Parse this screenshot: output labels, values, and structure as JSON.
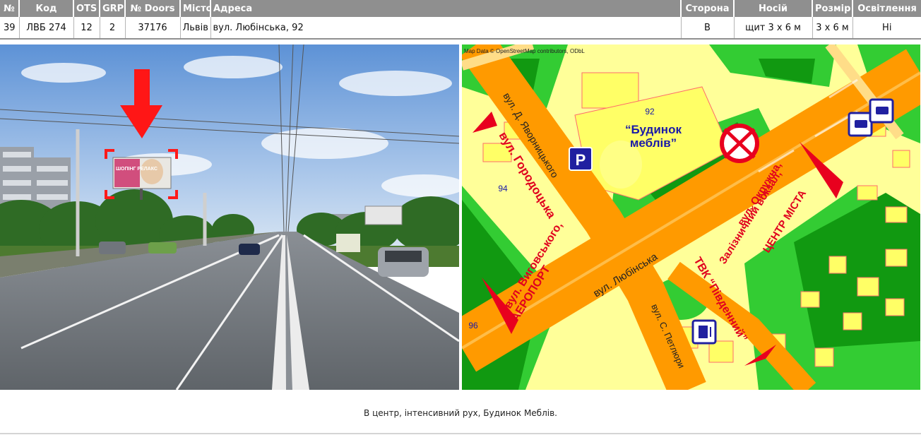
{
  "table": {
    "headers": [
      "№",
      "Код",
      "OTS",
      "GRP",
      "№ Doors",
      "Місто",
      "Адреса",
      "Сторона",
      "Носій",
      "Розмір",
      "Освітлення"
    ],
    "row": [
      "39",
      "ЛВБ 274",
      "12",
      "2",
      "37176",
      "Львів",
      "вул. Любінська, 92",
      "В",
      "щит 3 х 6 м",
      "3 х 6 м",
      "Ні"
    ]
  },
  "photo": {
    "billboard_text": "ШОПІНГ РЕЛАКС"
  },
  "map": {
    "attribution": "Map Data © OpenStreetMap contributors, ODbL",
    "house_92": "92",
    "house_94": "94",
    "house_96": "96",
    "parking_letter": "P",
    "furniture_line1": "“Будинок",
    "furniture_line2": "меблів”",
    "street_yavornytskoho": "вул. Д. Яворницького",
    "street_horodotska": "вул. Городоцька",
    "street_vyhovskoho_1": "вул. Виговського,",
    "street_vyhovskoho_2": "АЕРОПОРТ",
    "street_lyubinska": "вул. Любінська",
    "street_okruzhna_1": "вул. Окружна,",
    "street_okruzhna_2": "Залізничний вокзал,",
    "street_okruzhna_3": "ЦЕНТР МІСТА",
    "mall_name": "ТВК “Південний”",
    "street_petlyury": "вул. С. Петлюри"
  },
  "caption": "В центр, інтенсивний рух, Будинок Меблів.",
  "colors": {
    "header_bg": "#8f8f8f",
    "map_road": "#ff9a00",
    "map_block": "#ffff99",
    "map_green": "#33cc33",
    "map_label_red": "#e0001e",
    "map_label_blue": "#1a1aa8",
    "arrow_red": "#e8001e"
  }
}
